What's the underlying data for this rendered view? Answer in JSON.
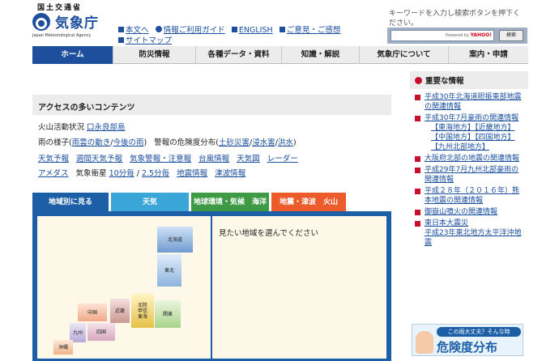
{
  "header": {
    "ministry": "国土交通省",
    "agency_name": "気象庁",
    "agency_name_en": "Japan Meteorological Agency",
    "util_links": [
      {
        "label": "本文へ",
        "icon": "square-bullet-icon"
      },
      {
        "label": "情報ご利用ガイド",
        "icon": "info-icon"
      },
      {
        "label": "ENGLISH",
        "icon": "square-bullet-icon"
      },
      {
        "label": "ご意見・ご感想",
        "icon": "square-bullet-icon"
      },
      {
        "label": "サイトマップ",
        "icon": "square-bullet-icon"
      }
    ],
    "search": {
      "hint": "キーワードを入力し検索ボタンを押下ください。",
      "powered_by": "Powered by",
      "provider": "YAHOO!",
      "button_label": "検索"
    }
  },
  "gnav": {
    "items": [
      {
        "label": "ホーム",
        "active": true
      },
      {
        "label": "防災情報",
        "active": false
      },
      {
        "label": "各種データ・資料",
        "active": false
      },
      {
        "label": "知識・解説",
        "active": false
      },
      {
        "label": "気象庁について",
        "active": false
      },
      {
        "label": "案内・申請",
        "active": false
      }
    ]
  },
  "access": {
    "title": "アクセスの多いコンテンツ",
    "volcano_label": "火山活動状況",
    "volcano_link": "口永良部島",
    "rain_label": "雨の様子(",
    "rain_link1": "雨雲の動き",
    "rain_sep": "/",
    "rain_link2": "今後の雨",
    "rain_close": ")",
    "warn_label": "警報の危険度分布(",
    "warn_link1": "土砂災害",
    "warn_link2": "浸水害",
    "warn_link3": "洪水",
    "warn_close": ")",
    "row3": [
      "天気予報",
      "週間天気予報",
      "気象警報・注意報",
      "台風情報",
      "天気図",
      "レーダー"
    ],
    "amedas": "アメダス",
    "sat_label": "気象衛星",
    "sat_10": "10分毎",
    "sat_sep": "/",
    "sat_25": "2.5分毎",
    "quake": "地震情報",
    "tsunami": "津波情報"
  },
  "tabs": [
    "地域別に見る",
    "天気",
    "地球環境・気候　海洋",
    "地震・津波　火山"
  ],
  "map": {
    "prompt": "見たい地域を選んでください",
    "regions": {
      "hokkaido": "北海道",
      "tohoku": "東北",
      "kanto": "関東",
      "hokuriku": "北陸\n甲信\n東海",
      "kinki": "近畿",
      "chugoku": "中国",
      "shikoku": "四国",
      "kyushu": "九州",
      "okinawa": "沖縄"
    }
  },
  "sidebar": {
    "title": "重要な情報",
    "items": [
      {
        "label": "平成30年北海道胆振東部地震の関連情報"
      },
      {
        "label": "平成30年7月豪雨の関連情報"
      }
    ],
    "subs": [
      "【東海地方】【近畿地方】",
      "【中国地方】【四国地方】",
      "【九州北部地方】"
    ],
    "items2": [
      {
        "label": "大阪府北部の地震の関連情報"
      },
      {
        "label": "平成29年7月九州北部豪雨の関連情報"
      },
      {
        "label": "平成２８年（２０１６年）熊本地震の関連情報"
      },
      {
        "label": "御嶽山噴火の関連情報"
      },
      {
        "label": "東日本大震災"
      }
    ],
    "tohoku_sub": "平成23年東北地方太平洋沖地震"
  },
  "banner": {
    "tagline": "この雨大丈夫？そんな時",
    "title": "危険度分布"
  }
}
